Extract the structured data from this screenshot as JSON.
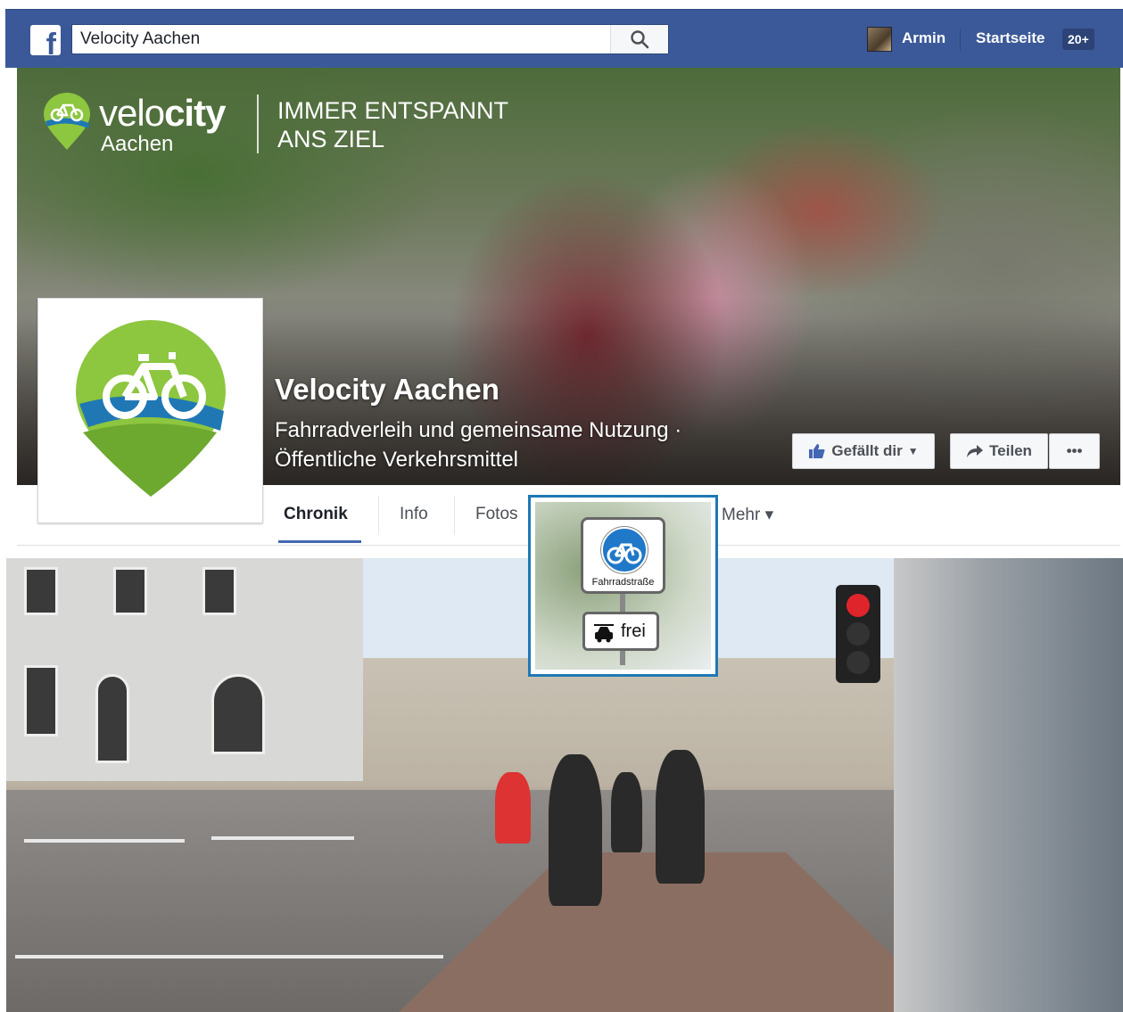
{
  "topbar": {
    "search_value": "Velocity Aachen",
    "user_name": "Armin",
    "home_label": "Startseite",
    "notif_badge": "20+"
  },
  "cover": {
    "brand_word_light": "velo",
    "brand_word_bold": "city",
    "brand_city": "Aachen",
    "tagline_line1": "IMMER ENTSPANNT",
    "tagline_line2": "ANS ZIEL",
    "page_title": "Velocity Aachen",
    "category_line1": "Fahrradverleih und gemeinsame Nutzung ·",
    "category_line2": "Öffentliche Verkehrsmittel",
    "like_label": "Gefällt dir",
    "share_label": "Teilen",
    "more_label": "•••"
  },
  "tabs": [
    {
      "label": "Chronik"
    },
    {
      "label": "Info"
    },
    {
      "label": "Fotos"
    },
    {
      "label": "Mehr ▾"
    }
  ],
  "sign": {
    "main_label": "Fahrradstraße",
    "sub_label": "frei"
  },
  "colors": {
    "fb_blue": "#3b5998",
    "tab_accent": "#4267b2",
    "logo_green": "#8dc63f",
    "logo_blue": "#1f78b4"
  }
}
